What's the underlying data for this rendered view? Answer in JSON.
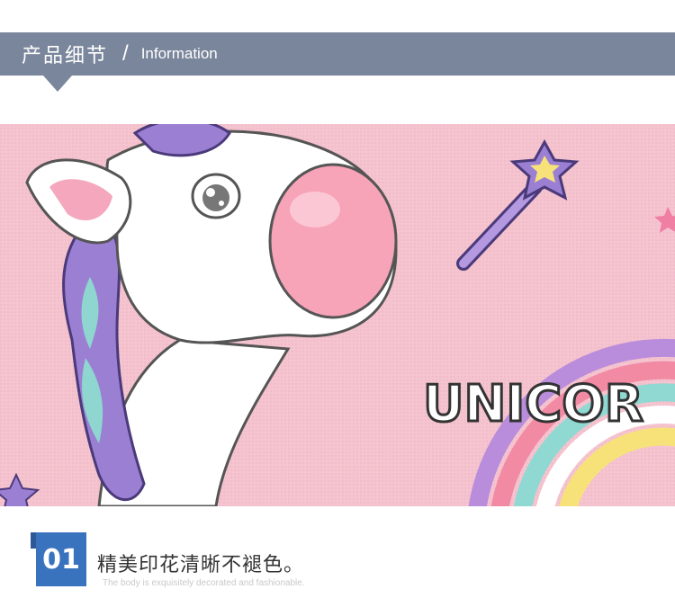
{
  "header": {
    "title": "产品细节",
    "separator": "/",
    "subtitle": "Information",
    "color": "#7a869b"
  },
  "photo": {
    "description_text": "UNICOR",
    "background_color": "#f5c4cf"
  },
  "feature": {
    "number": "01",
    "title": "精美印花清晰不褪色。",
    "subtitle": "The body is exquisitely decorated and fashionable.",
    "badge_color": "#3a73bd"
  }
}
